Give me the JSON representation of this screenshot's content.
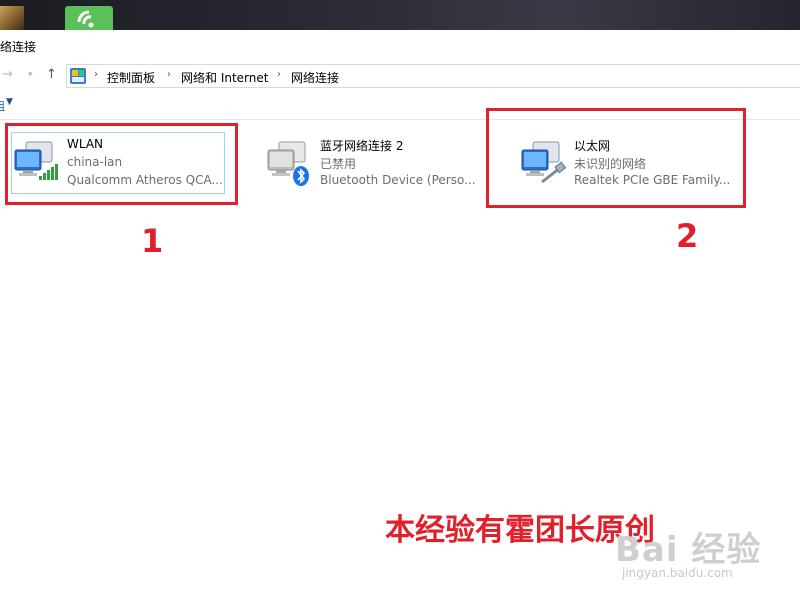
{
  "window": {
    "title": "络连接"
  },
  "address": {
    "crumbs": [
      "控制面板",
      "网络和 Internet",
      "网络连接"
    ]
  },
  "toolbar": {
    "label": "组"
  },
  "adapters": [
    {
      "name": "WLAN",
      "status": "china-lan",
      "device": "Qualcomm Atheros QCA...",
      "icon": "wifi-adapter-icon"
    },
    {
      "name": "蓝牙网络连接 2",
      "status": "已禁用",
      "device": "Bluetooth Device (Perso...",
      "icon": "bluetooth-adapter-icon"
    },
    {
      "name": "以太网",
      "status": "未识别的网络",
      "device": "Realtek PCIe GBE Family...",
      "icon": "ethernet-adapter-icon"
    }
  ],
  "annotations": {
    "label_1": "1",
    "label_2": "2",
    "caption": "本经验有霍团长原创",
    "highlight_color": "#e0202a"
  },
  "watermark": {
    "logo": "Bai 经验",
    "url": "jingyan.baidu.com"
  }
}
